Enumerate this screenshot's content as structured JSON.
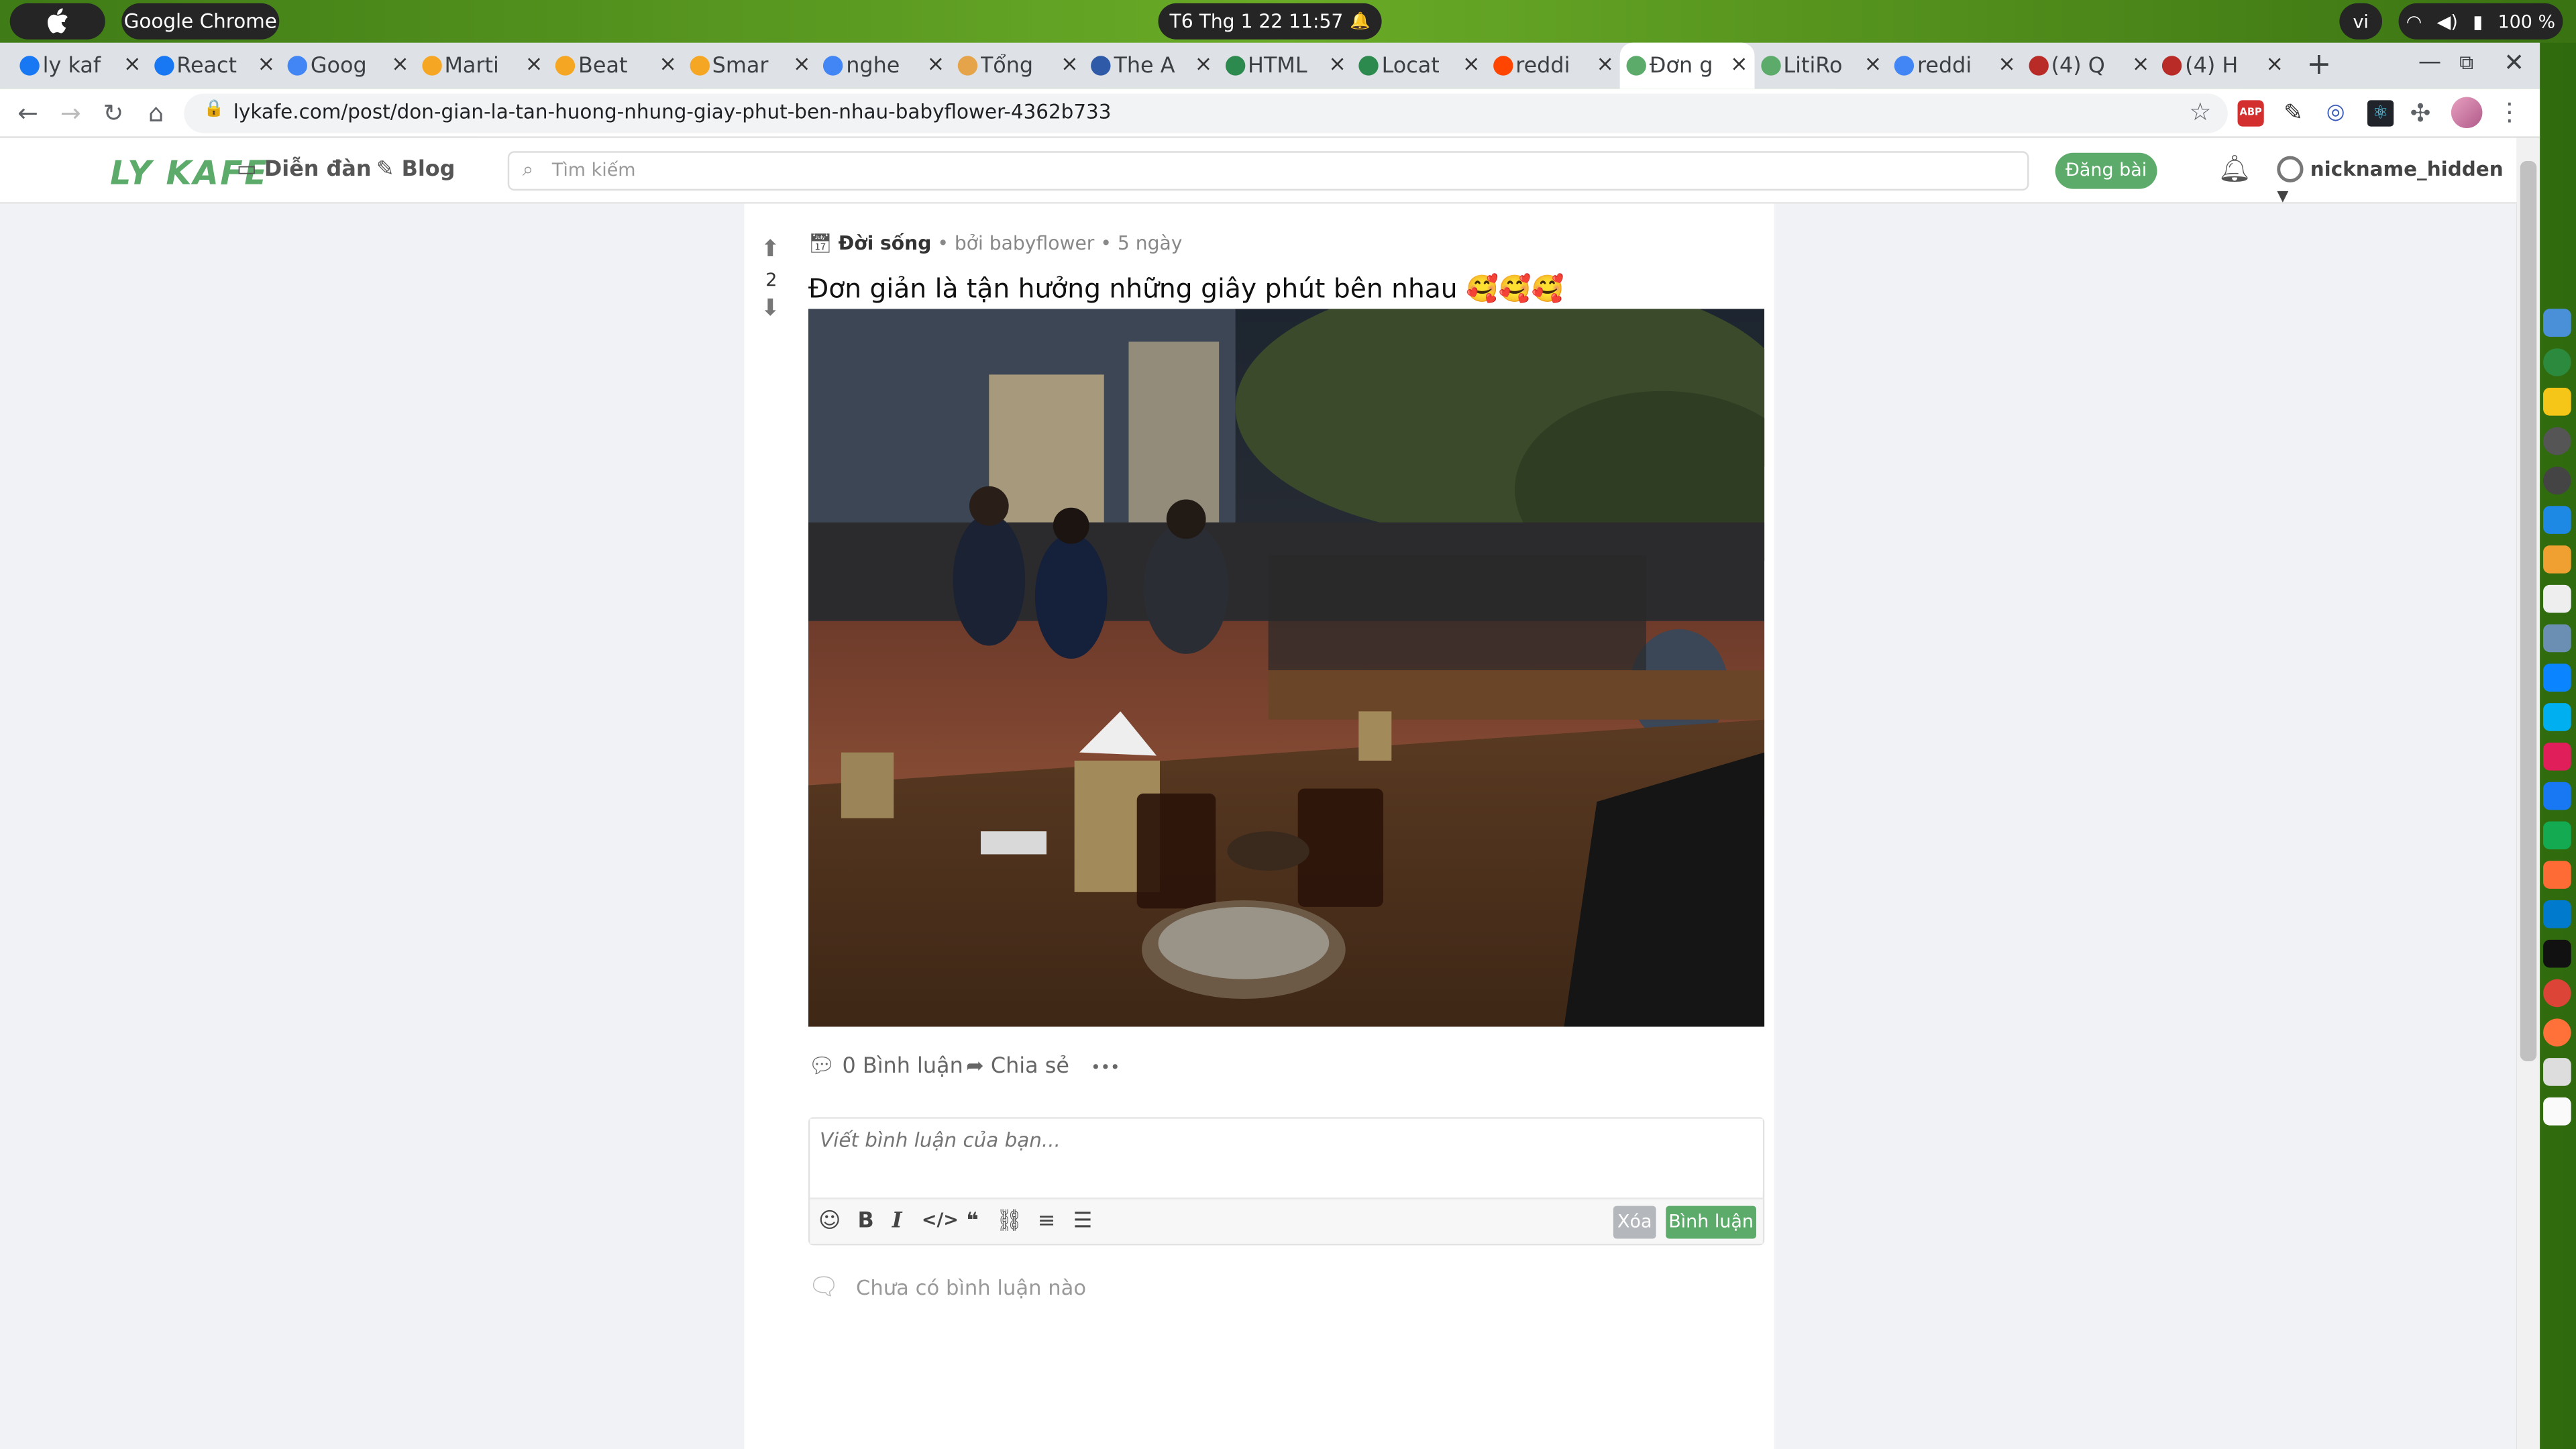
{
  "os": {
    "app_name": "Google Chrome",
    "datetime": "T6 Thg 1 22  11:57",
    "input_lang": "vi",
    "battery": "100 %"
  },
  "tabs": [
    {
      "label": "ly kaf",
      "favicon": "facebook-icon",
      "color": "#1877f2"
    },
    {
      "label": "React",
      "favicon": "facebook-icon",
      "color": "#1877f2"
    },
    {
      "label": "Goog",
      "favicon": "google-translate-icon",
      "color": "#4285f4"
    },
    {
      "label": "Marti",
      "favicon": "emoji-icon",
      "color": "#f5a623"
    },
    {
      "label": "Beat",
      "favicon": "emoji-icon",
      "color": "#f5a623"
    },
    {
      "label": "Smar",
      "favicon": "emoji-icon",
      "color": "#f5a623"
    },
    {
      "label": "nghe",
      "favicon": "google-icon",
      "color": "#4285f4"
    },
    {
      "label": "Tổng",
      "favicon": "circle-icon",
      "color": "#e5a44a"
    },
    {
      "label": "The A",
      "favicon": "site-icon",
      "color": "#2e5aa8"
    },
    {
      "label": "HTML",
      "favicon": "w-icon",
      "color": "#2d8a4e"
    },
    {
      "label": "Locat",
      "favicon": "w-icon",
      "color": "#2d8a4e"
    },
    {
      "label": "reddi",
      "favicon": "reddit-icon",
      "color": "#ff4500"
    },
    {
      "label": "Đơn g",
      "favicon": "lykafe-icon",
      "color": "#5cab6a"
    },
    {
      "label": "LitiRo",
      "favicon": "lykafe-icon",
      "color": "#5cab6a"
    },
    {
      "label": "reddi",
      "favicon": "google-icon",
      "color": "#4285f4"
    },
    {
      "label": "(4) Q",
      "favicon": "quora-icon",
      "color": "#b92b27"
    },
    {
      "label": "(4) H",
      "favicon": "quora-icon",
      "color": "#b92b27"
    }
  ],
  "browser": {
    "url": "lykafe.com/post/don-gian-la-tan-huong-nhung-giay-phut-ben-nhau-babyflower-4362b733"
  },
  "site": {
    "logo": "LY KAFE",
    "nav_forum": "Diễn đàn",
    "nav_blog": "Blog",
    "search_placeholder": "Tìm kiếm",
    "post_button": "Đăng bài",
    "username": "nickname_hidden"
  },
  "post": {
    "category": "Đời sống",
    "byline": "• bởi babyflower • 5 ngày",
    "title": "Đơn giản là tận hưởng những giây phút bên nhau 🥰🥰🥰",
    "votes": "2",
    "comments_action": "0 Bình luận",
    "share_action": "Chia sẻ",
    "more_action": "•••"
  },
  "comment_editor": {
    "placeholder": "Viết bình luận của bạn...",
    "clear_label": "Xóa",
    "submit_label": "Bình luận"
  },
  "empty_comments": "Chưa có bình luận nào"
}
